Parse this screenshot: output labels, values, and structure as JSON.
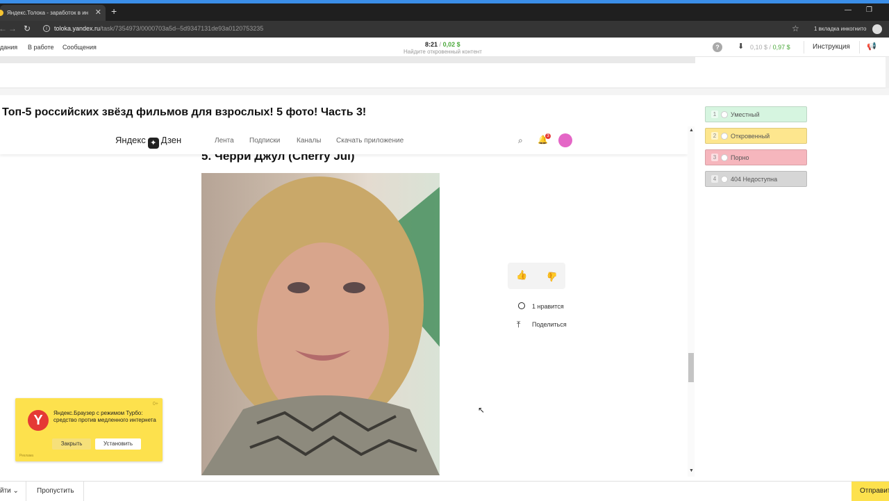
{
  "browser": {
    "tab_title": "Яндекс.Толока - заработок в ин",
    "tab_close": "✕",
    "new_tab": "+",
    "url_host": "toloka.yandex.ru",
    "url_path": "/task/7354973/0000703a5d--5d9347131de93a0120753235",
    "incognito_label": "1 вкладка инкогнито",
    "minimize": "—",
    "restore": "❐"
  },
  "toloka": {
    "nav": [
      "дания",
      "В работе",
      "Сообщения"
    ],
    "timer": "8:21",
    "timer_sep": "/",
    "timer_earned": "0,02 $",
    "task_hint": "Найдите откровенный контент",
    "balance_left": "0,10 $",
    "balance_sep": "/",
    "balance_right": "0,97 $",
    "instructions": "Инструкция",
    "help": "?"
  },
  "task": {
    "title": "Топ-5 российских звёзд фильмов для взрослых! 5 фото! Часть 3!"
  },
  "zen": {
    "logo_left": "Яндекс",
    "logo_mark": "✦",
    "logo_right": "Дзен",
    "nav": [
      "Лента",
      "Подписки",
      "Каналы",
      "Скачать приложение"
    ],
    "notifications_count": "3",
    "article_heading": "5. Черри Джул (Cherry Jul)",
    "likes": "1 нравится",
    "share": "Поделиться"
  },
  "options": [
    {
      "num": "1",
      "label": "Уместный",
      "color": "#d6f5e0"
    },
    {
      "num": "2",
      "label": "Откровенный",
      "color": "#fde68e"
    },
    {
      "num": "3",
      "label": "Порно",
      "color": "#f6b6bd"
    },
    {
      "num": "4",
      "label": "404 Недоступна",
      "color": "#d6d6d6"
    }
  ],
  "promo": {
    "age": "0+",
    "text": "Яндекс.Браузер с режимом Турбо: средство против медленного интернета",
    "close": "Закрыть",
    "install": "Установить",
    "ad": "Реклама"
  },
  "footer": {
    "exit": "йти ⌄",
    "skip": "Пропустить",
    "send": "Отправить"
  }
}
